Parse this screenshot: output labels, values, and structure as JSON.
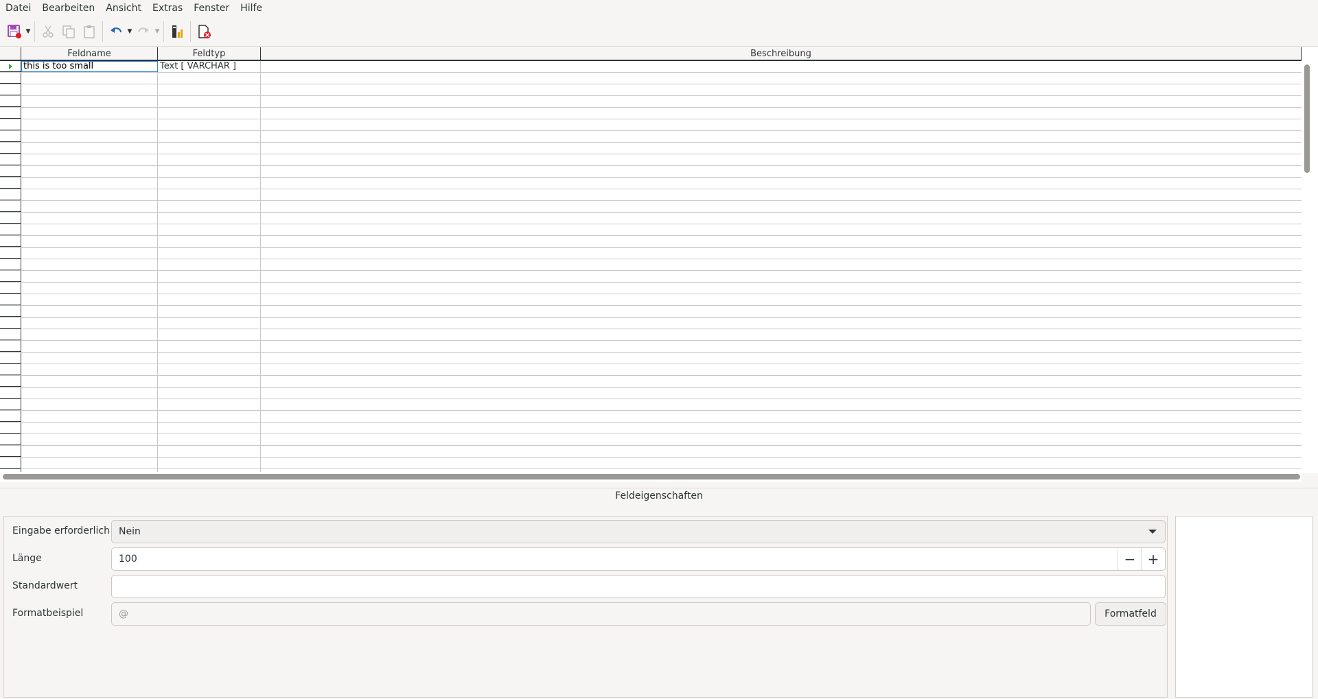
{
  "menu": [
    "Datei",
    "Bearbeiten",
    "Ansicht",
    "Extras",
    "Fenster",
    "Hilfe"
  ],
  "toolbar": {
    "buttons": [
      "save-icon",
      "cut-icon",
      "copy-icon",
      "paste-icon",
      "undo-icon",
      "redo-icon",
      "index-design-icon",
      "close-document-icon"
    ]
  },
  "table": {
    "headers": [
      "Feldname",
      "Feldtyp",
      "Beschreibung"
    ],
    "rows": [
      {
        "name": "this is too small",
        "type": "Text [ VARCHAR ]",
        "description": ""
      }
    ]
  },
  "properties": {
    "title": "Feldeigenschaften",
    "required_label": "Eingabe erforderlich",
    "required_value": "Nein",
    "length_label": "Länge",
    "length_value": "100",
    "default_label": "Standardwert",
    "default_value": "",
    "format_label": "Formatbeispiel",
    "format_value": "@",
    "format_button": "Formatfeld"
  },
  "colors": {
    "selection": "#3584e4",
    "row_marker": "#33aa33",
    "save_icon": "#a347ba"
  }
}
